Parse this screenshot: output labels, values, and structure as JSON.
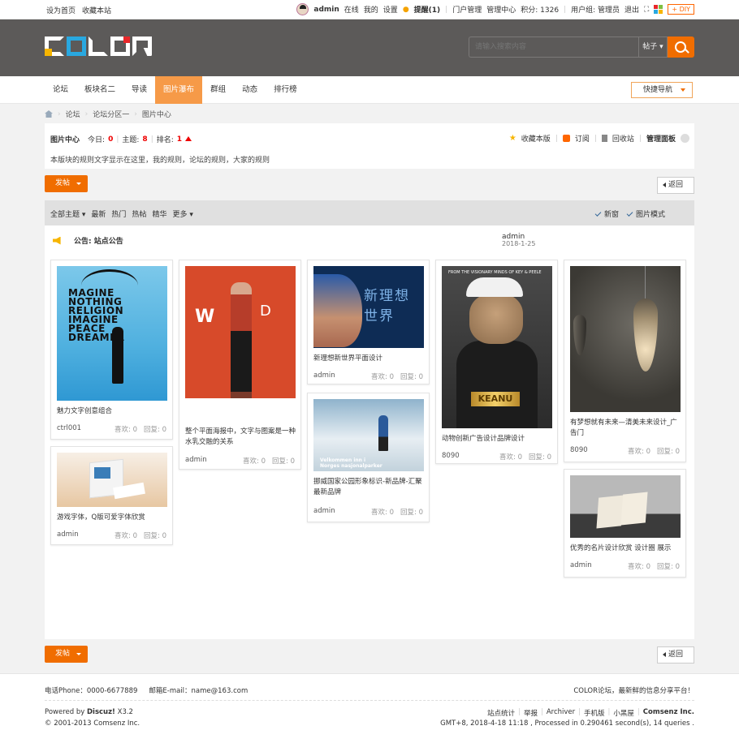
{
  "topbar": {
    "left": [
      "设为首页",
      "收藏本站"
    ],
    "user": "admin",
    "status": "在线",
    "my": "我的",
    "settings": "设置",
    "remind": "提醒(1)",
    "portal": "门户管理",
    "manage": "管理中心",
    "points": "积分: 1326",
    "usergroup": "用户组: 管理员",
    "logout": "退出",
    "diy": "DIY"
  },
  "header": {
    "logo_letters": [
      "C",
      "O",
      "L",
      "O",
      "R"
    ],
    "search_placeholder": "请输入搜索内容",
    "search_type": "帖子"
  },
  "nav": {
    "items": [
      "论坛",
      "板块名二",
      "导读",
      "图片瀑布",
      "群组",
      "动态",
      "排行榜"
    ],
    "active": "图片瀑布",
    "quick_nav": "快捷导航"
  },
  "breadcrumb": [
    "论坛",
    "论坛分区一",
    "图片中心"
  ],
  "forum": {
    "name": "图片中心",
    "today_label": "今日:",
    "today": "0",
    "topics_label": "主题:",
    "topics": "8",
    "rank_label": "排名:",
    "rank": "1",
    "favorite": "收藏本版",
    "subscribe": "订阅",
    "recycle": "回收站",
    "panel": "管理面板",
    "rules": "本版块的规则文字显示在这里，我的规则，论坛的规则，大家的规则"
  },
  "buttons": {
    "post": "发帖",
    "back": "返回"
  },
  "filter": {
    "items": [
      "全部主题",
      "最新",
      "热门",
      "热帖",
      "精华",
      "更多"
    ],
    "newwin": "新窗",
    "picmode": "图片模式"
  },
  "notice": {
    "label": "公告: 站点公告",
    "author": "admin",
    "date": "2018-1-25"
  },
  "cards": [
    {
      "title": "魅力文字创意组合",
      "author": "ctrl001",
      "likes": "喜欢: 0",
      "replies": "回复: 0"
    },
    {
      "title": "游戏字体，Q版可爱字体欣赏",
      "author": "admin",
      "likes": "喜欢: 0",
      "replies": "回复: 0"
    },
    {
      "title": "整个平面海报中，文字与图案是一种水乳交融的关系",
      "author": "admin",
      "likes": "喜欢: 0",
      "replies": "回复: 0"
    },
    {
      "title": "新理想新世界平面设计",
      "author": "admin",
      "likes": "喜欢: 0",
      "replies": "回复: 0"
    },
    {
      "title": "挪威国家公园形象标识-新品牌-汇聚最新品牌",
      "author": "admin",
      "likes": "喜欢: 0",
      "replies": "回复: 0"
    },
    {
      "title": "动物创新广告设计品牌设计",
      "author": "8090",
      "likes": "喜欢: 0",
      "replies": "回复: 0"
    },
    {
      "title": "有梦想就有未来—清美未来设计_广告门",
      "author": "8090",
      "likes": "喜欢: 0",
      "replies": "回复: 0"
    },
    {
      "title": "优秀的名片设计欣赏 设计圈 展示",
      "author": "admin",
      "likes": "喜欢: 0",
      "replies": "回复: 0"
    }
  ],
  "image_text": {
    "magine": "MAGINE\nNOTHING\nRELIGION\nIMAGINE\nPEACE\nDREAMER",
    "red_w": "W",
    "red_d": "D",
    "blue_ch": "新理想世界",
    "cat_top": "FROM THE VISIONARY MINDS OF KEY & PEELE",
    "cat_plate": "KEANU",
    "norway": "Velkommen inn i\nNorges nasjonalparker"
  },
  "footer": {
    "phone": "电话Phone：0000-6677889",
    "email": "邮箱E-mail：name@163.com",
    "slogan": "COLOR论坛，最新鲜的信息分享平台！",
    "powered_prefix": "Powered by ",
    "powered_brand": "Discuz!",
    "powered_version": " X3.2",
    "copyright": "© 2001-2013 Comsenz Inc.",
    "links": [
      "站点统计",
      "举报",
      "Archiver",
      "手机版",
      "小黑屋",
      "Comsenz Inc."
    ],
    "gmt": "GMT+8, 2018-4-18 11:18 , Processed in 0.290461 second(s), 14 queries ."
  }
}
